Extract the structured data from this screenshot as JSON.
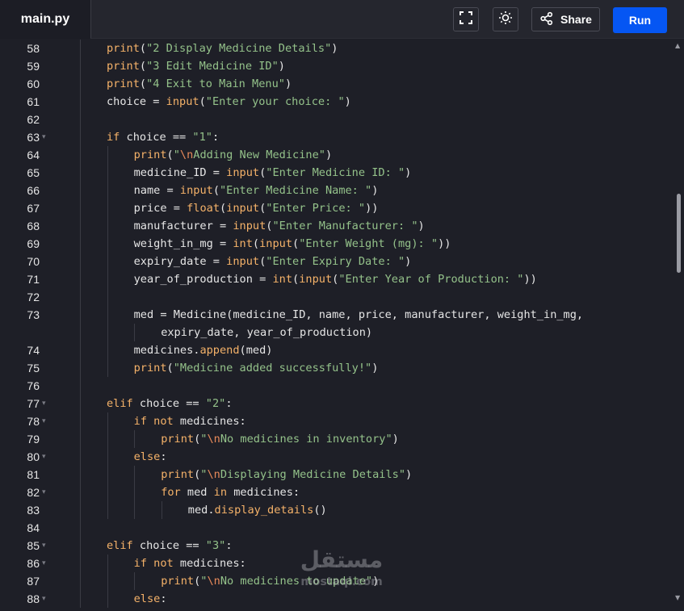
{
  "header": {
    "file_name": "main.py",
    "share_label": "Share",
    "run_label": "Run",
    "icons": [
      "fullscreen-icon",
      "theme-toggle-icon",
      "share-icon"
    ]
  },
  "colors": {
    "run_button": "#0556f3",
    "background": "#1e1f27",
    "keyword": "#f5b269",
    "string": "#94c28a"
  },
  "editor": {
    "lines": [
      {
        "num": "58",
        "fold": false,
        "indent": 1,
        "tokens": [
          [
            "fn",
            "print"
          ],
          [
            "p",
            "("
          ],
          [
            "str",
            "\"2 Display Medicine Details\""
          ],
          [
            "p",
            ")"
          ]
        ]
      },
      {
        "num": "59",
        "fold": false,
        "indent": 1,
        "tokens": [
          [
            "fn",
            "print"
          ],
          [
            "p",
            "("
          ],
          [
            "str",
            "\"3 Edit Medicine ID\""
          ],
          [
            "p",
            ")"
          ]
        ]
      },
      {
        "num": "60",
        "fold": false,
        "indent": 1,
        "tokens": [
          [
            "fn",
            "print"
          ],
          [
            "p",
            "("
          ],
          [
            "str",
            "\"4 Exit to Main Menu\""
          ],
          [
            "p",
            ")"
          ]
        ]
      },
      {
        "num": "61",
        "fold": false,
        "indent": 1,
        "tokens": [
          [
            "p",
            "choice = "
          ],
          [
            "fn",
            "input"
          ],
          [
            "p",
            "("
          ],
          [
            "str",
            "\"Enter your choice: \""
          ],
          [
            "p",
            ")"
          ]
        ]
      },
      {
        "num": "62",
        "fold": false,
        "indent": 1,
        "tokens": []
      },
      {
        "num": "63",
        "fold": true,
        "indent": 1,
        "tokens": [
          [
            "kw",
            "if"
          ],
          [
            "p",
            " choice == "
          ],
          [
            "str",
            "\"1\""
          ],
          [
            "p",
            ":"
          ]
        ]
      },
      {
        "num": "64",
        "fold": false,
        "indent": 2,
        "tokens": [
          [
            "fn",
            "print"
          ],
          [
            "p",
            "("
          ],
          [
            "str",
            "\""
          ],
          [
            "esc",
            "\\n"
          ],
          [
            "str",
            "Adding New Medicine\""
          ],
          [
            "p",
            ")"
          ]
        ]
      },
      {
        "num": "65",
        "fold": false,
        "indent": 2,
        "tokens": [
          [
            "p",
            "medicine_ID = "
          ],
          [
            "fn",
            "input"
          ],
          [
            "p",
            "("
          ],
          [
            "str",
            "\"Enter Medicine ID: \""
          ],
          [
            "p",
            ")"
          ]
        ]
      },
      {
        "num": "66",
        "fold": false,
        "indent": 2,
        "tokens": [
          [
            "p",
            "name = "
          ],
          [
            "fn",
            "input"
          ],
          [
            "p",
            "("
          ],
          [
            "str",
            "\"Enter Medicine Name: \""
          ],
          [
            "p",
            ")"
          ]
        ]
      },
      {
        "num": "67",
        "fold": false,
        "indent": 2,
        "tokens": [
          [
            "p",
            "price = "
          ],
          [
            "fn",
            "float"
          ],
          [
            "p",
            "("
          ],
          [
            "fn",
            "input"
          ],
          [
            "p",
            "("
          ],
          [
            "str",
            "\"Enter Price: \""
          ],
          [
            "p",
            "))"
          ]
        ]
      },
      {
        "num": "68",
        "fold": false,
        "indent": 2,
        "tokens": [
          [
            "p",
            "manufacturer = "
          ],
          [
            "fn",
            "input"
          ],
          [
            "p",
            "("
          ],
          [
            "str",
            "\"Enter Manufacturer: \""
          ],
          [
            "p",
            ")"
          ]
        ]
      },
      {
        "num": "69",
        "fold": false,
        "indent": 2,
        "tokens": [
          [
            "p",
            "weight_in_mg = "
          ],
          [
            "fn",
            "int"
          ],
          [
            "p",
            "("
          ],
          [
            "fn",
            "input"
          ],
          [
            "p",
            "("
          ],
          [
            "str",
            "\"Enter Weight (mg): \""
          ],
          [
            "p",
            "))"
          ]
        ]
      },
      {
        "num": "70",
        "fold": false,
        "indent": 2,
        "tokens": [
          [
            "p",
            "expiry_date = "
          ],
          [
            "fn",
            "input"
          ],
          [
            "p",
            "("
          ],
          [
            "str",
            "\"Enter Expiry Date: \""
          ],
          [
            "p",
            ")"
          ]
        ]
      },
      {
        "num": "71",
        "fold": false,
        "indent": 2,
        "tokens": [
          [
            "p",
            "year_of_production = "
          ],
          [
            "fn",
            "int"
          ],
          [
            "p",
            "("
          ],
          [
            "fn",
            "input"
          ],
          [
            "p",
            "("
          ],
          [
            "str",
            "\"Enter Year of Production: \""
          ],
          [
            "p",
            "))"
          ]
        ]
      },
      {
        "num": "72",
        "fold": false,
        "indent": 2,
        "tokens": []
      },
      {
        "num": "73",
        "fold": false,
        "indent": 2,
        "tokens": [
          [
            "p",
            "med = Medicine(medicine_ID, name, price, manufacturer, weight_in_mg,"
          ]
        ]
      },
      {
        "num": "",
        "fold": false,
        "indent": 3,
        "tokens": [
          [
            "p",
            "expiry_date, year_of_production)"
          ]
        ]
      },
      {
        "num": "74",
        "fold": false,
        "indent": 2,
        "tokens": [
          [
            "p",
            "medicines."
          ],
          [
            "fn",
            "append"
          ],
          [
            "p",
            "(med)"
          ]
        ]
      },
      {
        "num": "75",
        "fold": false,
        "indent": 2,
        "tokens": [
          [
            "fn",
            "print"
          ],
          [
            "p",
            "("
          ],
          [
            "str",
            "\"Medicine added successfully!\""
          ],
          [
            "p",
            ")"
          ]
        ]
      },
      {
        "num": "76",
        "fold": false,
        "indent": 1,
        "tokens": []
      },
      {
        "num": "77",
        "fold": true,
        "indent": 1,
        "tokens": [
          [
            "kw",
            "elif"
          ],
          [
            "p",
            " choice == "
          ],
          [
            "str",
            "\"2\""
          ],
          [
            "p",
            ":"
          ]
        ]
      },
      {
        "num": "78",
        "fold": true,
        "indent": 2,
        "tokens": [
          [
            "kw",
            "if not"
          ],
          [
            "p",
            " medicines:"
          ]
        ]
      },
      {
        "num": "79",
        "fold": false,
        "indent": 3,
        "tokens": [
          [
            "fn",
            "print"
          ],
          [
            "p",
            "("
          ],
          [
            "str",
            "\""
          ],
          [
            "esc",
            "\\n"
          ],
          [
            "str",
            "No medicines in inventory\""
          ],
          [
            "p",
            ")"
          ]
        ]
      },
      {
        "num": "80",
        "fold": true,
        "indent": 2,
        "tokens": [
          [
            "kw",
            "else"
          ],
          [
            "p",
            ":"
          ]
        ]
      },
      {
        "num": "81",
        "fold": false,
        "indent": 3,
        "tokens": [
          [
            "fn",
            "print"
          ],
          [
            "p",
            "("
          ],
          [
            "str",
            "\""
          ],
          [
            "esc",
            "\\n"
          ],
          [
            "str",
            "Displaying Medicine Details\""
          ],
          [
            "p",
            ")"
          ]
        ]
      },
      {
        "num": "82",
        "fold": true,
        "indent": 3,
        "tokens": [
          [
            "kw",
            "for"
          ],
          [
            "p",
            " med "
          ],
          [
            "kw",
            "in"
          ],
          [
            "p",
            " medicines:"
          ]
        ]
      },
      {
        "num": "83",
        "fold": false,
        "indent": 4,
        "tokens": [
          [
            "p",
            "med."
          ],
          [
            "fn",
            "display_details"
          ],
          [
            "p",
            "()"
          ]
        ]
      },
      {
        "num": "84",
        "fold": false,
        "indent": 1,
        "tokens": []
      },
      {
        "num": "85",
        "fold": true,
        "indent": 1,
        "tokens": [
          [
            "kw",
            "elif"
          ],
          [
            "p",
            " choice == "
          ],
          [
            "str",
            "\"3\""
          ],
          [
            "p",
            ":"
          ]
        ]
      },
      {
        "num": "86",
        "fold": true,
        "indent": 2,
        "tokens": [
          [
            "kw",
            "if not"
          ],
          [
            "p",
            " medicines:"
          ]
        ]
      },
      {
        "num": "87",
        "fold": false,
        "indent": 3,
        "tokens": [
          [
            "fn",
            "print"
          ],
          [
            "p",
            "("
          ],
          [
            "str",
            "\""
          ],
          [
            "esc",
            "\\n"
          ],
          [
            "str",
            "No medicines to update\""
          ],
          [
            "p",
            ")"
          ]
        ]
      },
      {
        "num": "88",
        "fold": true,
        "indent": 2,
        "tokens": [
          [
            "kw",
            "else"
          ],
          [
            "p",
            ":"
          ]
        ]
      }
    ]
  },
  "watermark": {
    "logo": "مستقل",
    "site": "mostaql.com"
  }
}
